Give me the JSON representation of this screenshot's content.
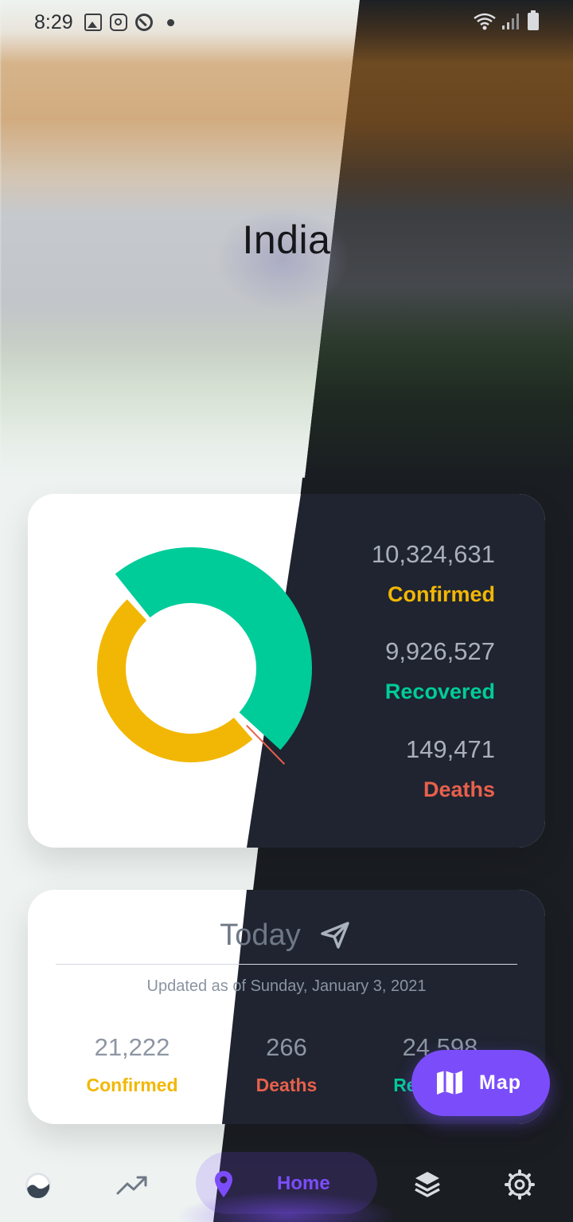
{
  "status_bar": {
    "time": "8:29",
    "icons": [
      "image-icon",
      "instagram-icon",
      "app-icon",
      "dot",
      "wifi-icon",
      "signal-icon",
      "battery-icon"
    ]
  },
  "header": {
    "country": "India"
  },
  "summary": {
    "confirmed_value": "10,324,631",
    "confirmed_label": "Confirmed",
    "recovered_value": "9,926,527",
    "recovered_label": "Recovered",
    "deaths_value": "149,471",
    "deaths_label": "Deaths"
  },
  "chart_data": {
    "type": "pie",
    "title": "",
    "categories": [
      "Confirmed",
      "Recovered",
      "Deaths"
    ],
    "values": [
      10324631,
      9926527,
      149471
    ],
    "colors": [
      "#f2b705",
      "#00cc99",
      "#e8604c"
    ]
  },
  "today": {
    "title": "Today",
    "updated": "Updated as of Sunday, January 3, 2021",
    "confirmed_value": "21,222",
    "confirmed_label": "Confirmed",
    "deaths_value": "266",
    "deaths_label": "Deaths",
    "recovered_value": "24,598",
    "recovered_label": "Recovered"
  },
  "fab": {
    "label": "Map",
    "icon": "map-icon"
  },
  "nav": {
    "items": [
      {
        "icon": "wave-icon"
      },
      {
        "icon": "trending-up-icon"
      },
      {
        "icon": "location-pin-icon",
        "label": "Home",
        "active": true
      },
      {
        "icon": "layers-icon"
      },
      {
        "icon": "settings-icon"
      }
    ]
  },
  "colors": {
    "confirmed": "#f2b705",
    "recovered": "#00cc99",
    "deaths": "#e8604c",
    "accent": "#7b4dfa"
  }
}
